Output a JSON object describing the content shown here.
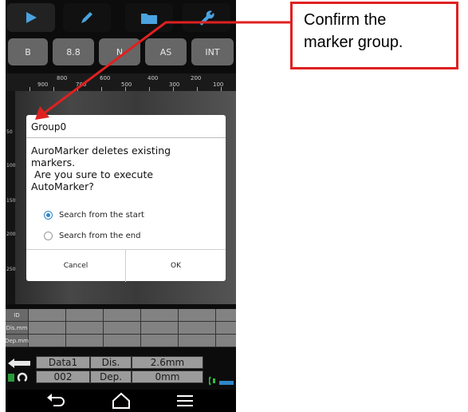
{
  "toolbar": {
    "icons": [
      "play-icon",
      "pencil-icon",
      "folder-icon",
      "wrench-icon"
    ]
  },
  "modes": [
    "B",
    "8.8",
    "N",
    "AS",
    "INT"
  ],
  "ruler": {
    "labels": [
      "900",
      "800",
      "700",
      "600",
      "500",
      "400",
      "300",
      "200",
      "100"
    ]
  },
  "vertical_scale": [
    "50",
    "100",
    "150",
    "200",
    "250"
  ],
  "dialog": {
    "title": "Group0",
    "message_lines": [
      "AuroMarker deletes existing",
      "markers.",
      " Are you sure to execute",
      "AutoMarker?"
    ],
    "options": [
      {
        "label": "Search from the start",
        "selected": true
      },
      {
        "label": "Search from the end",
        "selected": false
      }
    ],
    "cancel_label": "Cancel",
    "ok_label": "OK"
  },
  "table": {
    "row_labels": [
      "ID",
      "Dis.mm",
      "Dep.mm"
    ]
  },
  "bottom": {
    "data_name": "Data1",
    "dis_label": "Dis.",
    "dis_value": "2.6mm",
    "number": "002",
    "dep_label": "Dep.",
    "dep_value": "0mm"
  },
  "callout": {
    "line1": "Confirm the",
    "line2": "marker group."
  },
  "colors": {
    "accent": "#2f86c8",
    "callout_red": "#e02020"
  }
}
